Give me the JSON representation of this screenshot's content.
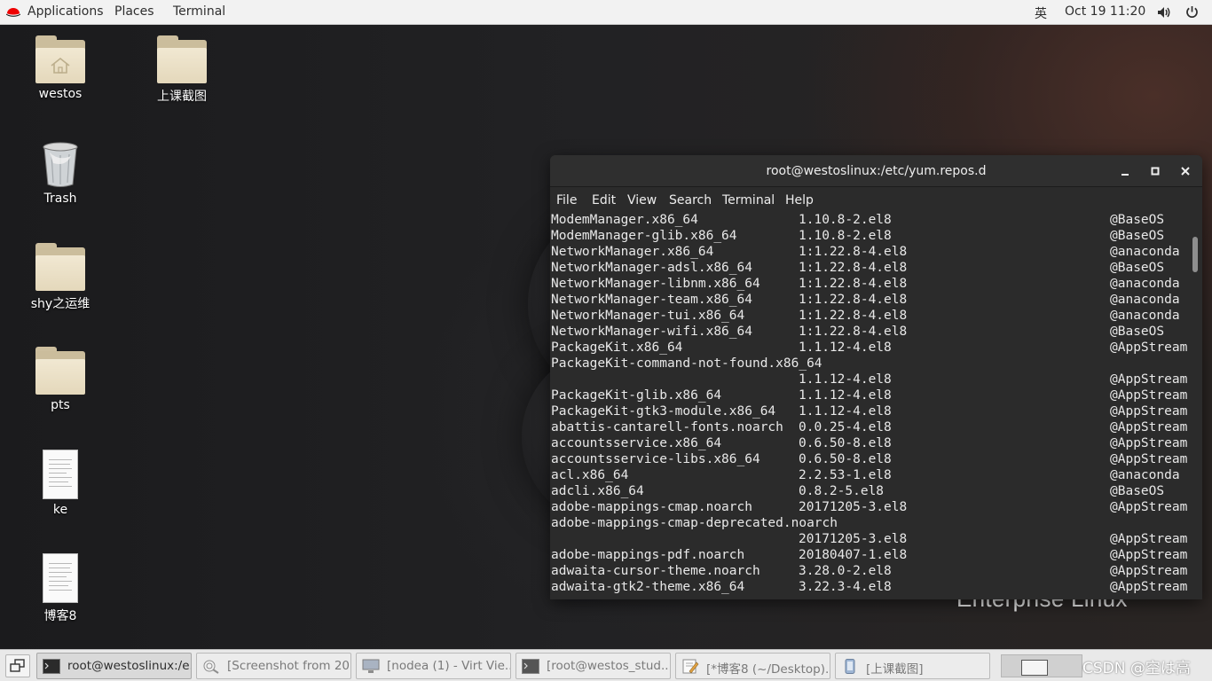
{
  "topbar": {
    "applications": "Applications",
    "places": "Places",
    "terminal": "Terminal",
    "input_method": "英",
    "datetime": "Oct 19  11:20"
  },
  "desktop": {
    "icons": [
      {
        "label": "westos",
        "icon": "home-folder-icon"
      },
      {
        "label": "上课截图",
        "icon": "folder-icon"
      },
      {
        "label": "Trash",
        "icon": "trash-icon"
      },
      {
        "label": "shy之运维",
        "icon": "folder-icon"
      },
      {
        "label": "pts",
        "icon": "folder-icon"
      },
      {
        "label": "ke",
        "icon": "document-icon"
      },
      {
        "label": "博客8",
        "icon": "document-icon"
      }
    ],
    "brand": "Enterprise Linux"
  },
  "terminal": {
    "title": "root@westoslinux:/etc/yum.repos.d",
    "menu": [
      "File",
      "Edit",
      "View",
      "Search",
      "Terminal",
      "Help"
    ],
    "rows": [
      {
        "name": "ModemManager.x86_64",
        "version": "1.10.8-2.el8",
        "repo": "@BaseOS"
      },
      {
        "name": "ModemManager-glib.x86_64",
        "version": "1.10.8-2.el8",
        "repo": "@BaseOS"
      },
      {
        "name": "NetworkManager.x86_64",
        "version": "1:1.22.8-4.el8",
        "repo": "@anaconda"
      },
      {
        "name": "NetworkManager-adsl.x86_64",
        "version": "1:1.22.8-4.el8",
        "repo": "@BaseOS"
      },
      {
        "name": "NetworkManager-libnm.x86_64",
        "version": "1:1.22.8-4.el8",
        "repo": "@anaconda"
      },
      {
        "name": "NetworkManager-team.x86_64",
        "version": "1:1.22.8-4.el8",
        "repo": "@anaconda"
      },
      {
        "name": "NetworkManager-tui.x86_64",
        "version": "1:1.22.8-4.el8",
        "repo": "@anaconda"
      },
      {
        "name": "NetworkManager-wifi.x86_64",
        "version": "1:1.22.8-4.el8",
        "repo": "@BaseOS"
      },
      {
        "name": "PackageKit.x86_64",
        "version": "1.1.12-4.el8",
        "repo": "@AppStream"
      },
      {
        "name": "PackageKit-command-not-found.x86_64",
        "version": "",
        "repo": ""
      },
      {
        "name": "",
        "version": "1.1.12-4.el8",
        "repo": "@AppStream"
      },
      {
        "name": "PackageKit-glib.x86_64",
        "version": "1.1.12-4.el8",
        "repo": "@AppStream"
      },
      {
        "name": "PackageKit-gtk3-module.x86_64",
        "version": "1.1.12-4.el8",
        "repo": "@AppStream"
      },
      {
        "name": "abattis-cantarell-fonts.noarch",
        "version": "0.0.25-4.el8",
        "repo": "@AppStream"
      },
      {
        "name": "accountsservice.x86_64",
        "version": "0.6.50-8.el8",
        "repo": "@AppStream"
      },
      {
        "name": "accountsservice-libs.x86_64",
        "version": "0.6.50-8.el8",
        "repo": "@AppStream"
      },
      {
        "name": "acl.x86_64",
        "version": "2.2.53-1.el8",
        "repo": "@anaconda"
      },
      {
        "name": "adcli.x86_64",
        "version": "0.8.2-5.el8",
        "repo": "@BaseOS"
      },
      {
        "name": "adobe-mappings-cmap.noarch",
        "version": "20171205-3.el8",
        "repo": "@AppStream"
      },
      {
        "name": "adobe-mappings-cmap-deprecated.noarch",
        "version": "",
        "repo": ""
      },
      {
        "name": "",
        "version": "20171205-3.el8",
        "repo": "@AppStream"
      },
      {
        "name": "adobe-mappings-pdf.noarch",
        "version": "20180407-1.el8",
        "repo": "@AppStream"
      },
      {
        "name": "adwaita-cursor-theme.noarch",
        "version": "3.28.0-2.el8",
        "repo": "@AppStream"
      },
      {
        "name": "adwaita-gtk2-theme.x86_64",
        "version": "3.22.3-4.el8",
        "repo": "@AppStream"
      }
    ]
  },
  "taskbar": {
    "tasks": [
      {
        "label": "root@westoslinux:/e...",
        "active": true
      },
      {
        "label": "[Screenshot from 20...",
        "active": false
      },
      {
        "label": "[nodea (1) - Virt Vie...",
        "active": false
      },
      {
        "label": "[root@westos_stud...",
        "active": false
      },
      {
        "label": "[*博客8 (~/Desktop)...",
        "active": false
      },
      {
        "label": "[上课截图]",
        "active": false
      }
    ],
    "watermark": "CSDN @空は高"
  },
  "colors": {
    "terminal_bg": "#2b2b2b",
    "terminal_fg": "#e8e8e8",
    "topbar_bg": "#f2f2f2",
    "taskbar_bg": "#e9e9e9",
    "redhat_red": "#ee0000"
  }
}
